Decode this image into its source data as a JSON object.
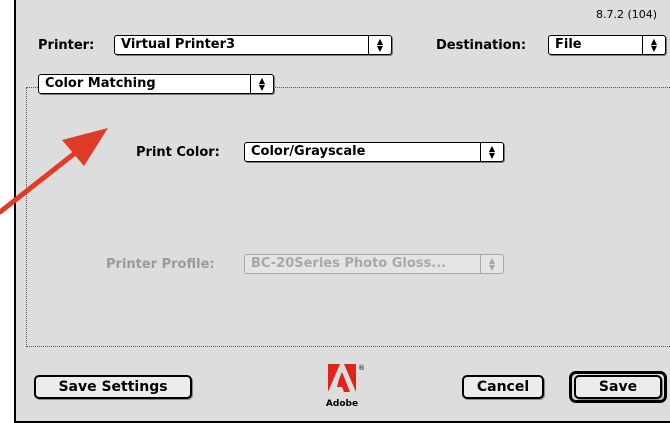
{
  "version": "8.7.2 (104)",
  "printer": {
    "label": "Printer:",
    "value": "Virtual Printer3"
  },
  "destination": {
    "label": "Destination:",
    "value": "File"
  },
  "panel_selector": {
    "value": "Color Matching"
  },
  "print_color": {
    "label": "Print Color:",
    "value": "Color/Grayscale"
  },
  "printer_profile": {
    "label": "Printer Profile:",
    "value": "BC-20Series Photo Gloss...",
    "enabled": false
  },
  "buttons": {
    "save_settings": "Save Settings",
    "cancel": "Cancel",
    "save": "Save"
  },
  "logo": {
    "text": "Adobe",
    "trademark": "®"
  },
  "icons": {
    "popup_arrows": "updown-arrows-icon",
    "annotation": "red-arrow-icon"
  },
  "colors": {
    "dialog_bg": "#dddddd",
    "annotation_arrow": "#e03a28",
    "adobe_red": "#e2231a",
    "disabled_text": "#9a9a9a"
  }
}
